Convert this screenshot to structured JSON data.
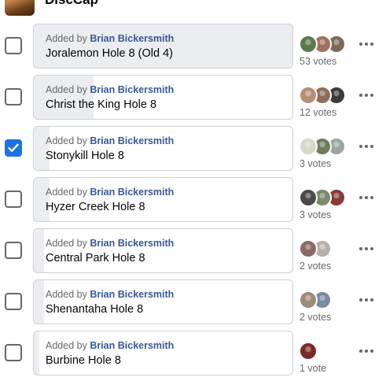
{
  "header": {
    "title": "DiscCap"
  },
  "poll": {
    "options": [
      {
        "added_prefix": "Added by",
        "author": "Brian Bickersmith",
        "name": "Joralemon Hole 8 (Old 4)",
        "votes_label": "53 votes",
        "checked": false,
        "share": 1.0,
        "voter_colors": [
          "#5b7a4a",
          "#a07060",
          "#7b6a5a"
        ]
      },
      {
        "added_prefix": "Added by",
        "author": "Brian Bickersmith",
        "name": "Christ the King Hole 8",
        "votes_label": "12 votes",
        "checked": false,
        "share": 0.23,
        "voter_colors": [
          "#b58f74",
          "#8d6e5a",
          "#3c3b3a"
        ]
      },
      {
        "added_prefix": "Added by",
        "author": "Brian Bickersmith",
        "name": "Stonykill Hole 8",
        "votes_label": "3 votes",
        "checked": true,
        "share": 0.06,
        "voter_colors": [
          "#d8d8c8",
          "#6f7d5a",
          "#9aa7a0"
        ]
      },
      {
        "added_prefix": "Added by",
        "author": "Brian Bickersmith",
        "name": "Hyzer Creek Hole 8",
        "votes_label": "3 votes",
        "checked": false,
        "share": 0.06,
        "voter_colors": [
          "#4c4a48",
          "#7a8a6a",
          "#8b3a3a"
        ]
      },
      {
        "added_prefix": "Added by",
        "author": "Brian Bickersmith",
        "name": "Central Park Hole 8",
        "votes_label": "2 votes",
        "checked": false,
        "share": 0.04,
        "voter_colors": [
          "#8a6a62",
          "#b8b0a8"
        ]
      },
      {
        "added_prefix": "Added by",
        "author": "Brian Bickersmith",
        "name": "Shenantaha Hole 8",
        "votes_label": "2 votes",
        "checked": false,
        "share": 0.04,
        "voter_colors": [
          "#a08a7a",
          "#7a8aa0"
        ]
      },
      {
        "added_prefix": "Added by",
        "author": "Brian Bickersmith",
        "name": "Burbine Hole 8",
        "votes_label": "1 vote",
        "checked": false,
        "share": 0.02,
        "voter_colors": [
          "#7a2a2a"
        ]
      }
    ]
  },
  "icons": {
    "checkmark": "check-icon",
    "more": "more-horizontal-icon",
    "avatar": "avatar"
  },
  "colors": {
    "accent": "#1b74e4",
    "author_link": "#385898",
    "fill": "#ebedf0"
  }
}
